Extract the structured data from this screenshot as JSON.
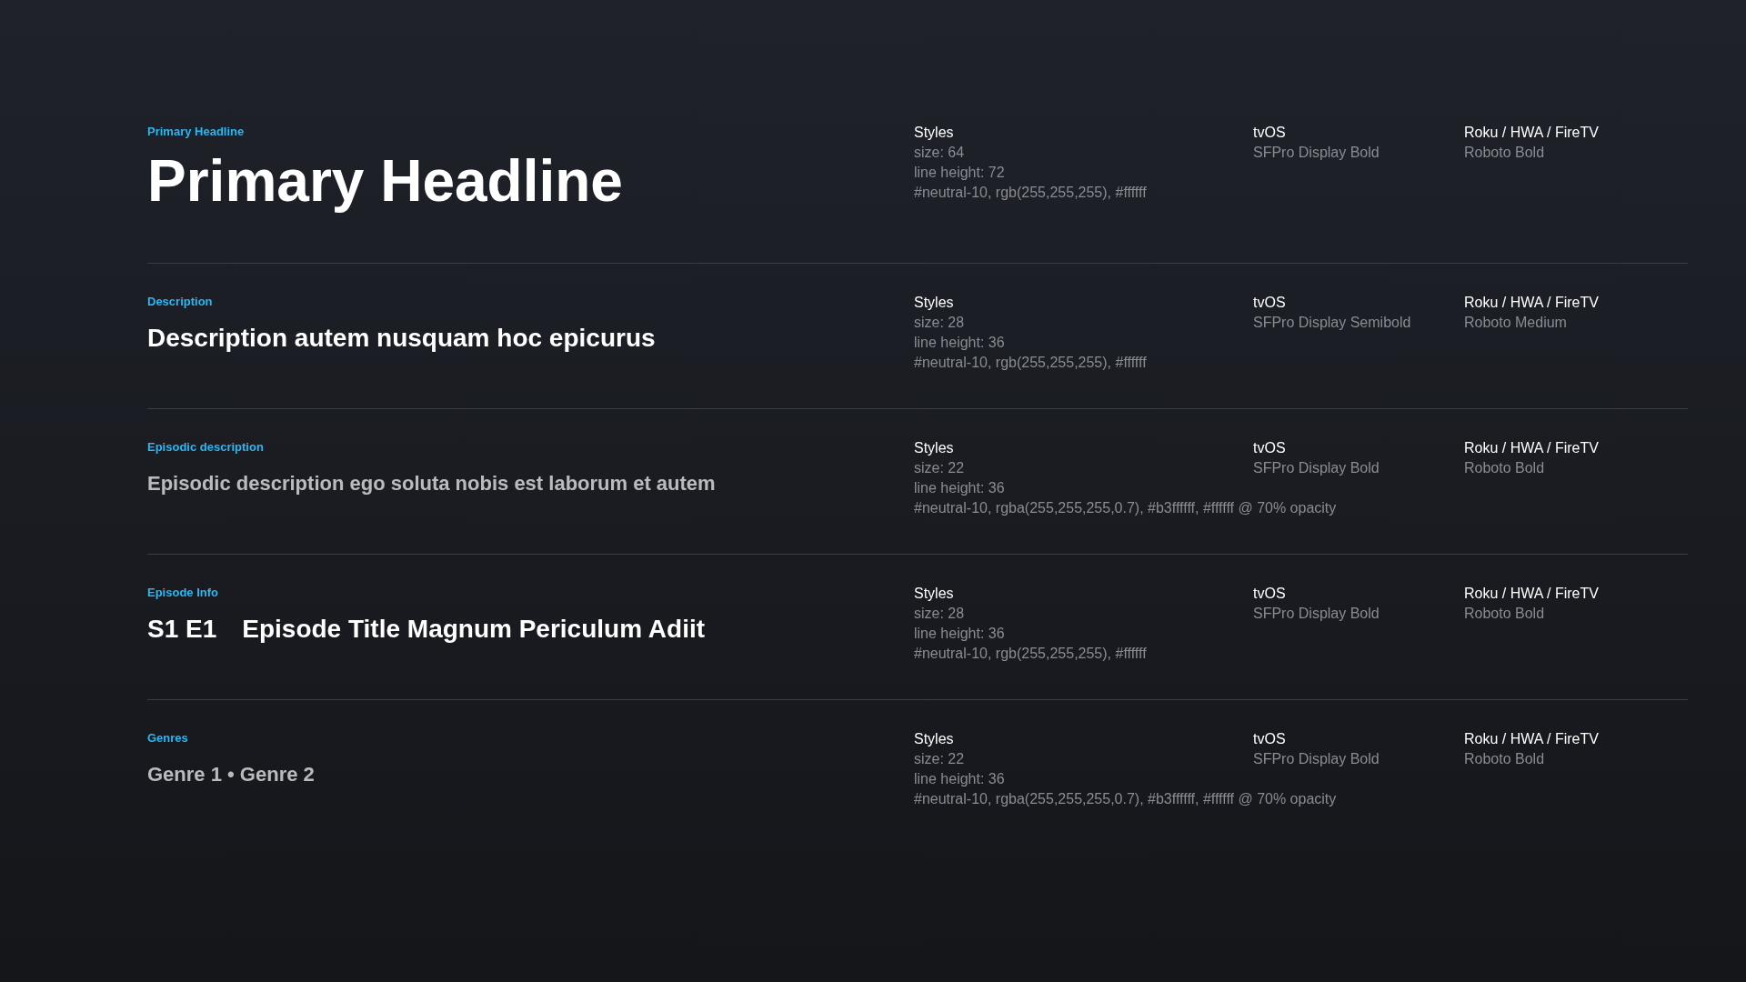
{
  "styles": [
    {
      "label": "Primary Headline",
      "kind": "headline",
      "sample": [
        "Primary Headline"
      ],
      "specs": {
        "heading": "Styles",
        "lines": [
          "size: 64",
          "line height: 72",
          "#neutral-10, rgb(255,255,255), #ffffff"
        ]
      },
      "tvos": {
        "heading": "tvOS",
        "font": "SFPro Display Bold"
      },
      "roku": {
        "heading": "Roku / HWA / FireTV",
        "font": "Roboto Bold"
      }
    },
    {
      "label": "Description",
      "kind": "description",
      "sample": [
        "Description autem nusquam hoc epicurus"
      ],
      "specs": {
        "heading": "Styles",
        "lines": [
          "size: 28",
          "line height: 36",
          "#neutral-10, rgb(255,255,255), #ffffff"
        ]
      },
      "tvos": {
        "heading": "tvOS",
        "font": "SFPro Display Semibold"
      },
      "roku": {
        "heading": "Roku / HWA / FireTV",
        "font": "Roboto Medium"
      }
    },
    {
      "label": "Episodic description",
      "kind": "muted",
      "sample": [
        "Episodic description ego soluta nobis est laborum et autem"
      ],
      "specs": {
        "heading": "Styles",
        "lines": [
          "size: 22",
          "line height: 36",
          "#neutral-10, rgba(255,255,255,0.7), #b3ffffff, #ffffff @ 70% opacity"
        ]
      },
      "tvos": {
        "heading": "tvOS",
        "font": "SFPro Display Bold"
      },
      "roku": {
        "heading": "Roku / HWA / FireTV",
        "font": "Roboto Bold"
      }
    },
    {
      "label": "Episode Info",
      "kind": "title",
      "sample": [
        "S1 E1",
        "Episode Title Magnum Periculum Adiit"
      ],
      "specs": {
        "heading": "Styles",
        "lines": [
          "size: 28",
          "line height: 36",
          "#neutral-10, rgb(255,255,255), #ffffff"
        ]
      },
      "tvos": {
        "heading": "tvOS",
        "font": "SFPro Display Bold"
      },
      "roku": {
        "heading": "Roku / HWA / FireTV",
        "font": "Roboto Bold"
      }
    },
    {
      "label": "Genres",
      "kind": "muted",
      "sample": [
        "Genre 1 • Genre 2"
      ],
      "specs": {
        "heading": "Styles",
        "lines": [
          "size: 22",
          "line height: 36",
          "#neutral-10, rgba(255,255,255,0.7), #b3ffffff, #ffffff @ 70% opacity"
        ]
      },
      "tvos": {
        "heading": "tvOS",
        "font": "SFPro Display Bold"
      },
      "roku": {
        "heading": "Roku / HWA / FireTV",
        "font": "Roboto Bold"
      }
    }
  ]
}
